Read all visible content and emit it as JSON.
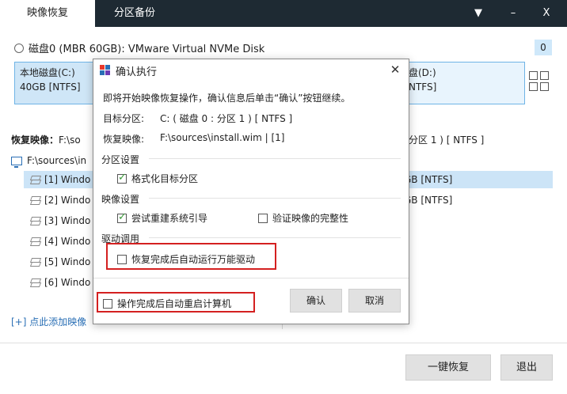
{
  "tabs": {
    "active": "映像恢复",
    "inactive": "分区备份"
  },
  "window_controls": {
    "dropdown": "▼",
    "minimize": "–",
    "close": "X"
  },
  "disk": {
    "label": "磁盘0 (MBR 60GB): VMware Virtual NVMe Disk",
    "count": "0"
  },
  "partitions": [
    {
      "label": "本地磁盘(C:)",
      "size": "40GB [NTFS]"
    },
    {
      "label": "盘(D:)",
      "size": "NTFS]"
    }
  ],
  "restore": {
    "label": "恢复映像：",
    "path_prefix": "F:\\so",
    "target_tail": "分区 1 ) [ NTFS ]",
    "tree_root": "F:\\sources\\in"
  },
  "image_list": [
    {
      "name": "[1] Windo",
      "right": "GB [NTFS]"
    },
    {
      "name": "[2] Windo",
      "right": "GB [NTFS]"
    },
    {
      "name": "[3] Windo",
      "right": ""
    },
    {
      "name": "[4] Windo",
      "right": ""
    },
    {
      "name": "[5] Windo",
      "right": ""
    },
    {
      "name": "[6] Windo",
      "right": ""
    }
  ],
  "add_link": "[+] 点此添加映像",
  "buttons": {
    "restore": "一键恢复",
    "exit": "退出"
  },
  "dialog": {
    "title": "确认执行",
    "close": "✕",
    "intro": "即将开始映像恢复操作，确认信息后单击“确认”按钮继续。",
    "target_label": "目标分区:",
    "target_value": "C: ( 磁盘 0 : 分区 1 ) [ NTFS ]",
    "image_label": "恢复映像:",
    "image_value": "F:\\sources\\install.wim | [1]",
    "section_partition": "分区设置",
    "opt_format": "格式化目标分区",
    "section_image": "映像设置",
    "opt_boot": "尝试重建系统引导",
    "opt_verify": "验证映像的完整性",
    "section_driver": "驱动调用",
    "opt_driver": "恢复完成后自动运行万能驱动",
    "opt_reboot": "操作完成后自动重启计算机",
    "btn_ok": "确认",
    "btn_cancel": "取消"
  },
  "colors": {
    "topbar": "#1e2a33",
    "accent": "#6fb4e6",
    "highlight": "#cce4f7",
    "red_box": "#d42020"
  }
}
